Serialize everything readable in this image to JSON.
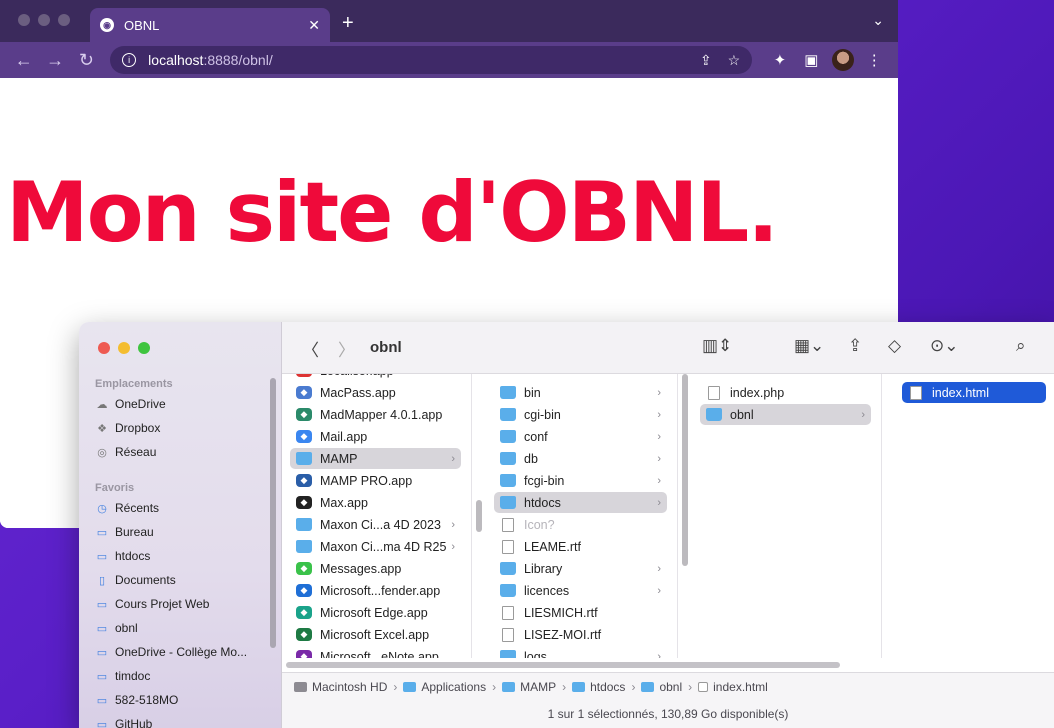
{
  "browser": {
    "tab": {
      "title": "OBNL",
      "close": "✕"
    },
    "new_tab": "+",
    "tab_menu": "⌄",
    "nav": {
      "back": "←",
      "forward": "→",
      "reload": "↻"
    },
    "url_host": "localhost",
    "url_path": ":8888/obnl/",
    "page_heading": "Mon site d'OBNL."
  },
  "finder": {
    "title": "obnl",
    "sidebar": {
      "locations_header": "Emplacements",
      "locations": [
        {
          "label": "OneDrive",
          "icon": "cloud-icon"
        },
        {
          "label": "Dropbox",
          "icon": "dropbox-icon"
        },
        {
          "label": "Réseau",
          "icon": "network-icon"
        }
      ],
      "favorites_header": "Favoris",
      "favorites": [
        {
          "label": "Récents",
          "icon": "clock-icon"
        },
        {
          "label": "Bureau",
          "icon": "desktop-icon"
        },
        {
          "label": "htdocs",
          "icon": "folder-icon"
        },
        {
          "label": "Documents",
          "icon": "document-icon"
        },
        {
          "label": "Cours Projet Web",
          "icon": "folder-icon"
        },
        {
          "label": "obnl",
          "icon": "folder-icon"
        },
        {
          "label": "OneDrive - Collège Mo...",
          "icon": "folder-icon"
        },
        {
          "label": "timdoc",
          "icon": "folder-icon"
        },
        {
          "label": "582-518MO",
          "icon": "folder-icon"
        },
        {
          "label": "GitHub",
          "icon": "folder-icon"
        }
      ]
    },
    "column1": [
      {
        "label": "Localisor.app",
        "type": "app",
        "color": "#d33"
      },
      {
        "label": "MacPass.app",
        "type": "app",
        "color": "#4a7bd0"
      },
      {
        "label": "MadMapper 4.0.1.app",
        "type": "app",
        "color": "#2b8a6a"
      },
      {
        "label": "Mail.app",
        "type": "app",
        "color": "#3a86f0"
      },
      {
        "label": "MAMP",
        "type": "folder",
        "selected": true,
        "chevron": "›"
      },
      {
        "label": "MAMP PRO.app",
        "type": "app",
        "color": "#2a5ea8"
      },
      {
        "label": "Max.app",
        "type": "app",
        "color": "#222"
      },
      {
        "label": "Maxon Ci...a 4D 2023",
        "type": "folder",
        "chevron": "›"
      },
      {
        "label": "Maxon Ci...ma 4D R25",
        "type": "folder",
        "chevron": "›"
      },
      {
        "label": "Messages.app",
        "type": "app",
        "color": "#3ac24a"
      },
      {
        "label": "Microsoft...fender.app",
        "type": "app",
        "color": "#1f6fd6"
      },
      {
        "label": "Microsoft Edge.app",
        "type": "app",
        "color": "#1aa38a"
      },
      {
        "label": "Microsoft Excel.app",
        "type": "app",
        "color": "#1e7a44"
      },
      {
        "label": "Microsoft...eNote.app",
        "type": "app",
        "color": "#7a2aa8"
      }
    ],
    "column2": [
      {
        "label": "bin",
        "type": "folder",
        "chevron": "›"
      },
      {
        "label": "cgi-bin",
        "type": "folder",
        "chevron": "›"
      },
      {
        "label": "conf",
        "type": "folder",
        "chevron": "›"
      },
      {
        "label": "db",
        "type": "folder",
        "chevron": "›"
      },
      {
        "label": "fcgi-bin",
        "type": "folder",
        "chevron": "›"
      },
      {
        "label": "htdocs",
        "type": "folder",
        "selected": true,
        "chevron": "›"
      },
      {
        "label": "Icon?",
        "type": "doc",
        "dim": true
      },
      {
        "label": "LEAME.rtf",
        "type": "doc"
      },
      {
        "label": "Library",
        "type": "folder",
        "chevron": "›"
      },
      {
        "label": "licences",
        "type": "folder",
        "chevron": "›"
      },
      {
        "label": "LIESMICH.rtf",
        "type": "doc"
      },
      {
        "label": "LISEZ-MOI.rtf",
        "type": "doc"
      },
      {
        "label": "logs",
        "type": "folder",
        "chevron": "›"
      }
    ],
    "column3": [
      {
        "label": "index.php",
        "type": "doc"
      },
      {
        "label": "obnl",
        "type": "folder",
        "selected": true,
        "chevron": "›"
      }
    ],
    "column4": [
      {
        "label": "index.html",
        "type": "chrome-doc",
        "selected_blue": true
      }
    ],
    "path": [
      "Macintosh HD",
      "Applications",
      "MAMP",
      "htdocs",
      "obnl",
      "index.html"
    ],
    "path_separator": "›",
    "status": "1 sur 1 sélectionnés, 130,89 Go disponible(s)"
  }
}
